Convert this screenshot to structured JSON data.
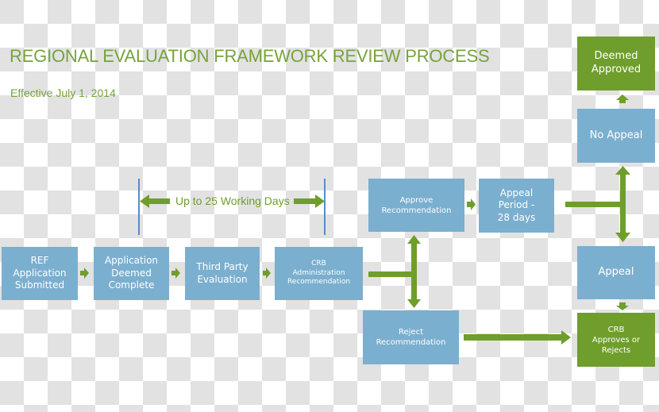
{
  "header": {
    "title": "REGIONAL EVALUATION FRAMEWORK REVIEW PROCESS",
    "subtitle": "Effective July 1, 2014"
  },
  "timeline": {
    "label": "Up to 25 Working Days"
  },
  "colors": {
    "process_box": "#7bafcf",
    "outcome_box": "#6f9e2c",
    "arrow": "#6f9e2c",
    "title_text": "#77a33a",
    "timeline_marker": "#5b8bc4"
  },
  "steps": {
    "ref_submitted": "REF\nApplication\nSubmitted",
    "deemed_complete": "Application\nDeemed\nComplete",
    "third_party": "Third Party\nEvaluation",
    "crb_admin": "CRB\nAdministration\nRecommendation",
    "approve_rec": "Approve\nRecommendation",
    "reject_rec": "Reject\nRecommendation",
    "appeal_period": "Appeal\nPeriod -\n28 days",
    "no_appeal": "No Appeal",
    "deemed_approved": "Deemed\nApproved",
    "appeal": "Appeal",
    "crb_decides": "CRB\nApproves or\nRejects"
  }
}
